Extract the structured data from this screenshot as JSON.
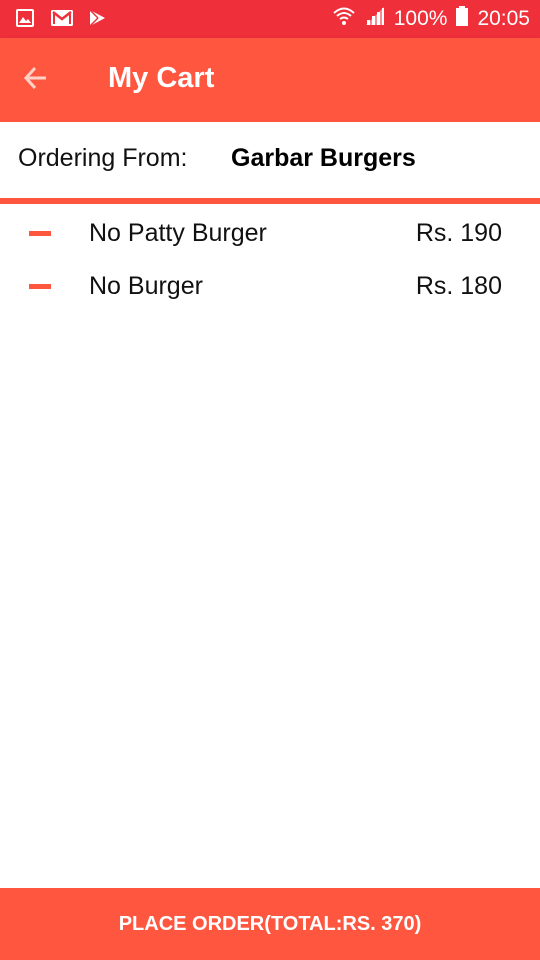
{
  "status_bar": {
    "battery_percent": "100%",
    "time": "20:05",
    "left_icons": [
      "gallery-icon",
      "gmail-icon",
      "play-store-icon"
    ],
    "right_icons": [
      "wifi-icon",
      "signal-icon",
      "battery-icon"
    ]
  },
  "app_bar": {
    "title": "My Cart",
    "back_icon": "arrow-left-icon"
  },
  "ordering": {
    "label": "Ordering From:",
    "restaurant": "Garbar Burgers"
  },
  "cart": {
    "items": [
      {
        "name": "No Patty Burger",
        "price": "Rs. 190"
      },
      {
        "name": "No Burger",
        "price": "Rs. 180"
      }
    ]
  },
  "footer": {
    "place_order_label": "PLACE ORDER(TOTAL:RS. 370)"
  },
  "colors": {
    "status_bar": "#EF2F3A",
    "accent": "#FF5640",
    "text": "#111111",
    "background": "#FFFFFF"
  }
}
